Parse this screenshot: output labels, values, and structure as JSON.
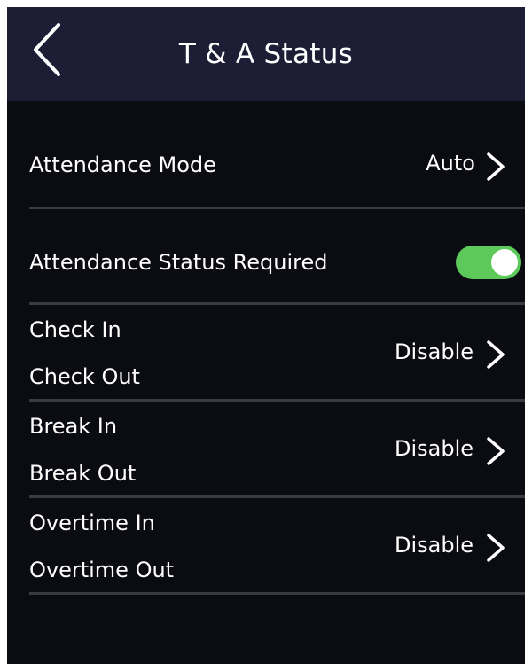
{
  "header": {
    "title": "T & A Status",
    "back_icon": "chevron-left-icon"
  },
  "rows": [
    {
      "label": "Attendance Mode",
      "value": "Auto"
    },
    {
      "label": "Attendance Status Required",
      "toggle_on": true
    },
    {
      "label_1": "Check In",
      "label_2": "Check Out",
      "value": "Disable"
    },
    {
      "label_1": "Break In",
      "label_2": "Break Out",
      "value": "Disable"
    },
    {
      "label_1": "Overtime In",
      "label_2": "Overtime Out",
      "value": "Disable"
    }
  ],
  "colors": {
    "header_bg": "#1d1d35",
    "screen_bg": "#0b0b12",
    "toggle_on": "#5cc95a",
    "divider": "#3a3a42"
  }
}
